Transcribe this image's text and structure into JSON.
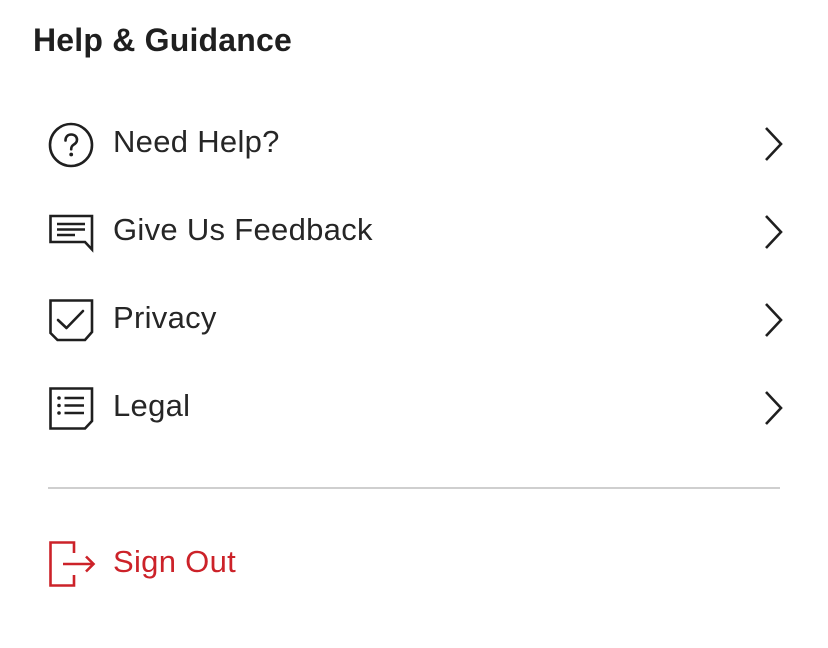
{
  "section": {
    "title": "Help & Guidance"
  },
  "menu": {
    "items": [
      {
        "label": "Need Help?",
        "icon": "question-circle-icon"
      },
      {
        "label": "Give Us Feedback",
        "icon": "feedback-message-icon"
      },
      {
        "label": "Privacy",
        "icon": "privacy-shield-check-icon"
      },
      {
        "label": "Legal",
        "icon": "legal-document-list-icon"
      }
    ]
  },
  "signout": {
    "label": "Sign Out",
    "icon": "sign-out-icon"
  },
  "colors": {
    "text": "#262626",
    "accent": "#cc2229",
    "divider": "#cfcfcf",
    "background": "#ffffff"
  }
}
